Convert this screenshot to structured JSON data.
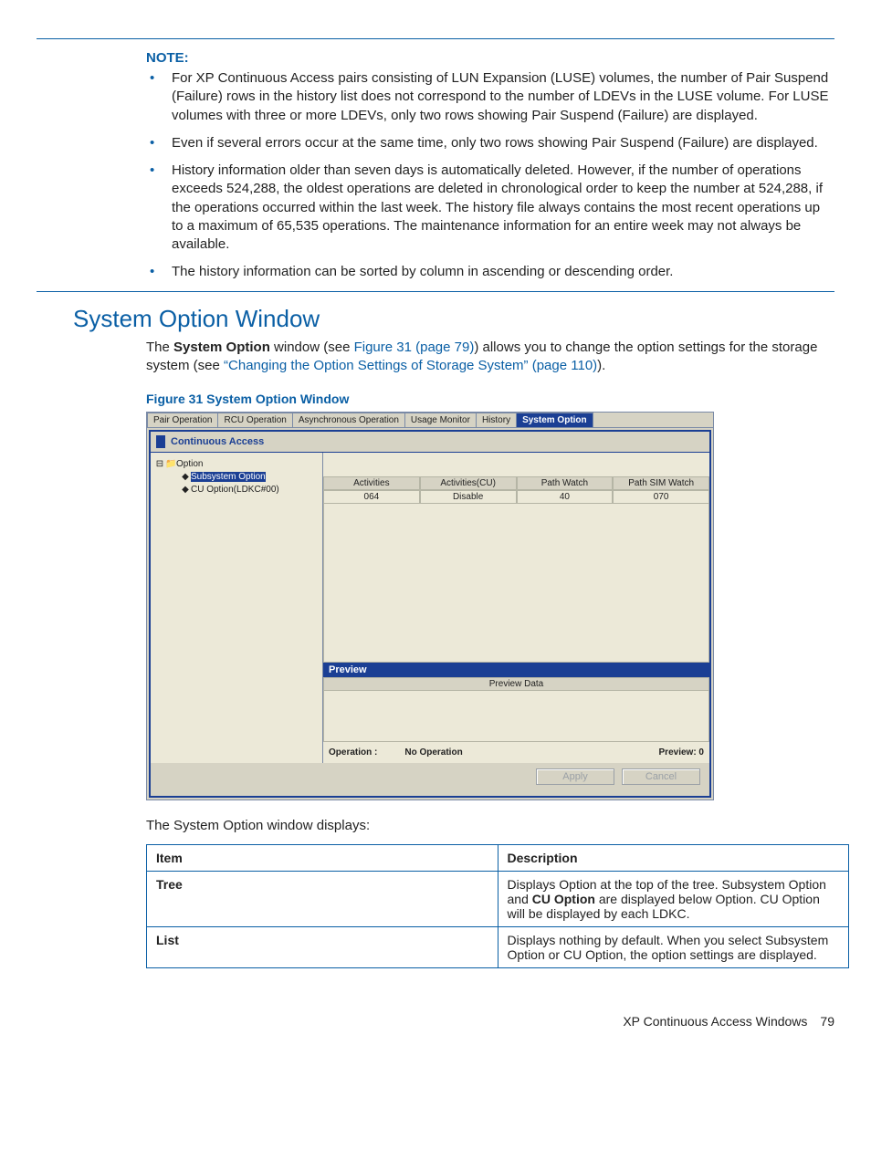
{
  "note": {
    "label": "NOTE:",
    "bullets": [
      "For XP Continuous Access pairs consisting of LUN Expansion (LUSE) volumes, the number of Pair Suspend (Failure) rows in the history list does not correspond to the number of LDEVs in the LUSE volume. For LUSE volumes with three or more LDEVs, only two rows showing Pair Suspend (Failure) are displayed.",
      "Even if several errors occur at the same time, only two rows showing Pair Suspend (Failure) are displayed.",
      "History information older than seven days is automatically deleted. However, if the number of operations exceeds 524,288, the oldest operations are deleted in chronological order to keep the number at 524,288, if the operations occurred within the last week. The history file always contains the most recent operations up to a maximum of 65,535 operations. The maintenance information for an entire week may not always be available.",
      "The history information can be sorted by column in ascending or descending order."
    ]
  },
  "section": {
    "heading": "System Option Window",
    "para_pre": "The ",
    "para_bold": "System Option",
    "para_mid": " window (see ",
    "link1": "Figure 31 (page 79)",
    "para_mid2": ") allows you to change the option settings for the storage system (see ",
    "link2": "“Changing the Option Settings of Storage System” (page 110)",
    "para_end": ")."
  },
  "figure": {
    "caption": "Figure 31 System Option Window",
    "tabs": [
      "Pair Operation",
      "RCU Operation",
      "Asynchronous Operation",
      "Usage Monitor",
      "History",
      "System Option"
    ],
    "active_tab_index": 5,
    "panel_title": "Continuous Access",
    "tree": {
      "root": "Option",
      "child_selected": "Subsystem Option",
      "child2": "CU Option(LDKC#00)"
    },
    "list": {
      "headers": [
        "Activities",
        "Activities(CU)",
        "Path Watch",
        "Path SIM Watch"
      ],
      "row": [
        "064",
        "Disable",
        "40",
        "070"
      ]
    },
    "preview_label": "Preview",
    "preview_data_label": "Preview Data",
    "status": {
      "op_label": "Operation :",
      "op_value": "No Operation",
      "preview_label": "Preview: 0"
    },
    "buttons": {
      "apply": "Apply",
      "cancel": "Cancel"
    }
  },
  "after_text": "The System Option window displays:",
  "desc_table": {
    "head_item": "Item",
    "head_desc": "Description",
    "rows": [
      {
        "item": "Tree",
        "desc_pre": "Displays Option at the top of the tree. Subsystem Option and ",
        "desc_bold": "CU Option",
        "desc_post": " are displayed below Option. CU Option will be displayed by each LDKC."
      },
      {
        "item": "List",
        "desc_pre": "Displays nothing by default. When you select Subsystem Option or CU Option, the option settings are displayed.",
        "desc_bold": "",
        "desc_post": ""
      }
    ]
  },
  "footer": {
    "title": "XP Continuous Access Windows",
    "page": "79"
  }
}
